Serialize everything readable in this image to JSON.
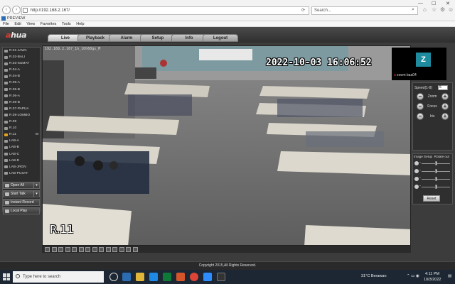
{
  "browser": {
    "url": "http://192.168.2.167/",
    "search_placeholder": "Search...",
    "tab_title": "PREVIEW",
    "menu": [
      "File",
      "Edit",
      "View",
      "Favorites",
      "Tools",
      "Help"
    ]
  },
  "app": {
    "logo_a": "a",
    "logo_rest": "hua",
    "tabs": [
      "Live",
      "Playback",
      "Alarm",
      "Setup",
      "Info",
      "Logout"
    ],
    "active_tab": "Live",
    "cameras": [
      "R.01-JAWA",
      "R.02-BALI",
      "R.03-SUMAT",
      "R.04-A",
      "R.04-B",
      "R.05-A",
      "R.05-B",
      "R.06-A",
      "R.06-B",
      "R.07-PAPUA",
      "R.08-LOMBO",
      "R.09",
      "R.10",
      "R.11",
      "LAB-A",
      "LAB-B",
      "LAB-C",
      "LAB-D",
      "LAB-JRGN",
      "LAB-PUSAT"
    ],
    "active_camera": "R.11",
    "active_camera_marker": "M",
    "side_buttons": [
      "Open All",
      "Start Talk",
      "Instant Record",
      "Local Play"
    ],
    "footer": "Copyright 2015,All Rights Reserved."
  },
  "video": {
    "osd_ip": "192.168.2.167_1h_10h60gs_M",
    "osd_time": "2022-10-03 16:06:52",
    "osd_room": "R.11"
  },
  "zoom": {
    "avatar_letter": "Z",
    "name": "zoom baa04"
  },
  "ptz": {
    "speed_label": "Speed(1-8)",
    "speed_value": "5",
    "zoom_label": "Zoom",
    "focus_label": "Focus",
    "iris_label": "Iris"
  },
  "image_setup": {
    "tab_image": "Image Setup",
    "tab_rotate": "Rotate out",
    "reset_label": "Reset",
    "levels": [
      0.5,
      0.5,
      0.5,
      0.5
    ]
  },
  "taskbar": {
    "search_placeholder": "Type here to search",
    "weather": "31°C  Berawan",
    "time": "4:11 PM",
    "date": "10/3/2022"
  }
}
